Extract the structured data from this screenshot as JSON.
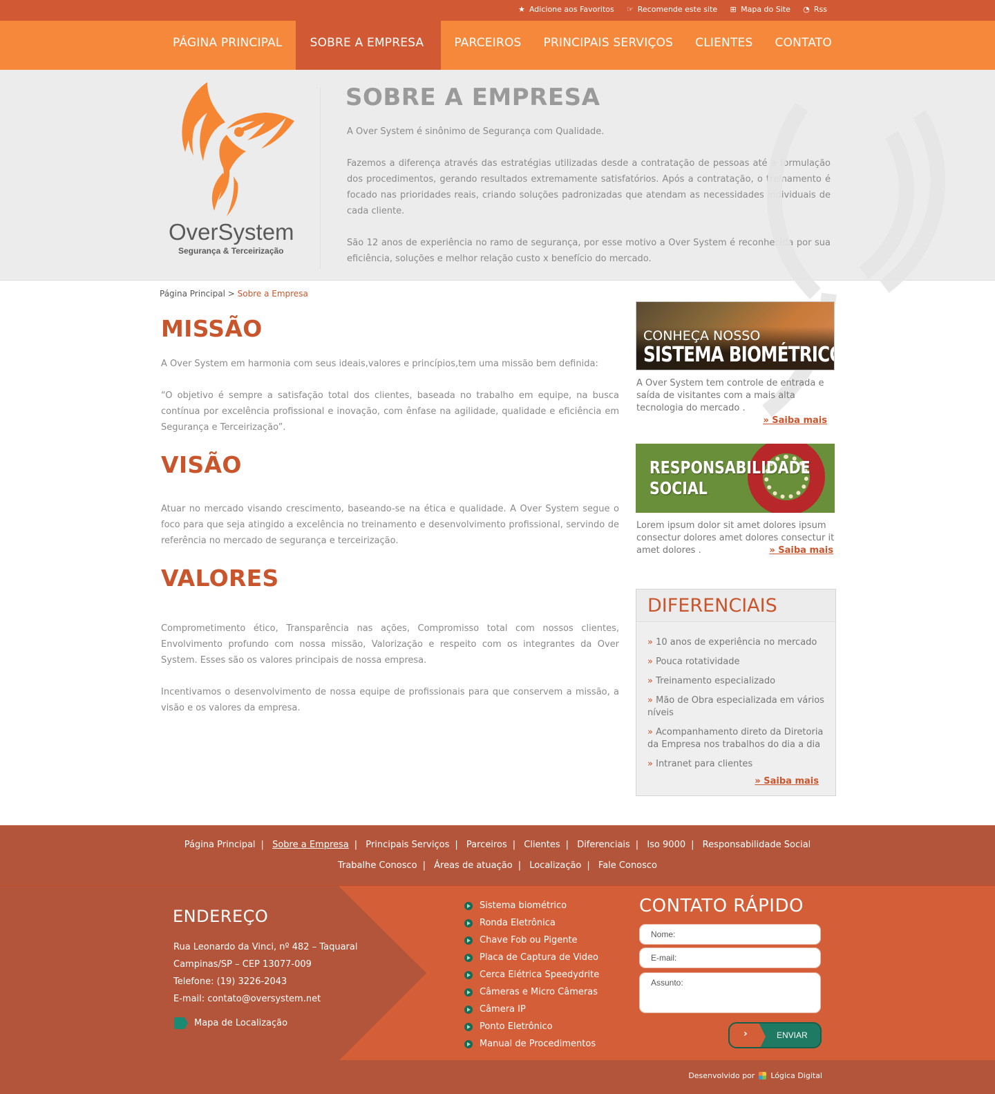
{
  "toplinks": [
    {
      "icon": "star-icon",
      "glyph": "★",
      "label": "Adicione aos Favoritos"
    },
    {
      "icon": "thumbs-up-icon",
      "glyph": "☞",
      "label": "Recomende este site"
    },
    {
      "icon": "sitemap-icon",
      "glyph": "⊞",
      "label": "Mapa do Site"
    },
    {
      "icon": "rss-icon",
      "glyph": "◔",
      "label": "Rss"
    }
  ],
  "nav": [
    {
      "label": "PÁGINA PRINCIPAL",
      "active": false
    },
    {
      "label": "SOBRE A EMPRESA",
      "active": true
    },
    {
      "label": "PARCEIROS",
      "active": false
    },
    {
      "label": "PRINCIPAIS SERVIÇOS",
      "active": false
    },
    {
      "label": "CLIENTES",
      "active": false
    },
    {
      "label": "CONTATO",
      "active": false
    }
  ],
  "logo": {
    "name": "OverSystem",
    "tagline": "Segurança & Terceirização"
  },
  "hero": {
    "title": "SOBRE A EMPRESA",
    "p1": "A Over System é sinônimo de Segurança com Qualidade.",
    "p2": "Fazemos a diferença através das estratégias utilizadas desde a contratação de pessoas até a formulação dos procedimentos, gerando resultados extremamente satisfatórios. Após a contratação, o treinamento é focado nas prioridades reais, criando soluções padronizadas que atendam as necessidades individuais de cada cliente.",
    "p3": "São 12 anos de experiência no ramo de segurança, por esse motivo a Over System é reconhecida por sua eficiência, soluções e melhor relação custo x benefício do mercado."
  },
  "breadcrumb": {
    "home": "Página Principal",
    "sep": ">",
    "current": "Sobre a Empresa"
  },
  "missao": {
    "title": "MISSÃO",
    "p1": "A Over System em harmonia com seus ideais,valores e princípios,tem uma missão bem definida:",
    "p2": "“O objetivo é sempre a satisfação total dos clientes, baseada no trabalho em equipe, na busca contínua por excelência profissional e inovação, com ênfase na agilidade, qualidade e eficiência em Segurança e Terceirização”."
  },
  "visao": {
    "title": "VISÃO",
    "p1": "Atuar no mercado visando crescimento, baseando-se na ética e qualidade. A Over System segue o foco para que seja atingido a excelência no treinamento e desenvolvimento profissional, servindo de referência no mercado de segurança e terceirização."
  },
  "valores": {
    "title": "VALORES",
    "p1": "Comprometimento ético, Transparência nas ações, Compromisso total com nossos clientes, Envolvimento profundo com nossa missão, Valorização e respeito com os integrantes da Over System. Esses são os valores principais de nossa empresa.",
    "p2": "Incentivamos o desenvolvimento de nossa equipe de profissionais para que conservem a missão, a visão e os valores da empresa."
  },
  "promo1": {
    "line1": "CONHEÇA NOSSO",
    "line2": "SISTEMA BIOMÉTRICO",
    "text": "A Over System tem controle de entrada e saída de visitantes com a mais alta tecnologia do mercado .",
    "more": "» Saiba mais"
  },
  "promo2": {
    "line1": "RESPONSABILIDADE",
    "line2": "SOCIAL",
    "text": "Lorem ipsum dolor sit amet dolores ipsum consectur dolores amet dolores consectur it amet dolores .",
    "more": "» Saiba mais"
  },
  "diferenciais": {
    "title": "DIFERENCIAIS",
    "items": [
      "10 anos de experiência no mercado",
      "Pouca rotatividade",
      "Treinamento especializado",
      "Mão de Obra especializada em vários níveis",
      "Acompanhamento direto da Diretoria da Empresa nos trabalhos do dia a dia",
      "Intranet para clientes"
    ],
    "more": "» Saiba mais"
  },
  "footer_nav": {
    "row1": [
      "Página Principal",
      "Sobre a Empresa",
      "Principais Serviços",
      "Parceiros",
      "Clientes",
      "Diferenciais",
      "Iso 9000",
      "Responsabilidade Social"
    ],
    "row2": [
      "Trabalhe Conosco",
      "Áreas de atuação",
      "Localização",
      "Fale Conosco"
    ],
    "separator": "|"
  },
  "endereco": {
    "title": "ENDEREÇO",
    "lines": [
      "Rua Leonardo da Vinci, nº 482 – Taquaral",
      "Campinas/SP – CEP 13077-009",
      "Telefone: (19) 3226-2043",
      "E-mail: contato@oversystem.net"
    ],
    "map": "Mapa de Localização"
  },
  "servicos": [
    "Sistema biométrico",
    "Ronda Eletrônica",
    "Chave Fob ou Pigente",
    "Placa de Captura de Video",
    "Cerca Elétrica Speedydrite",
    "Câmeras e Micro Câmeras",
    "Câmera IP",
    "Ponto Eletrônico",
    "Manual de Procedimentos"
  ],
  "contato": {
    "title": "CONTATO RÁPIDO",
    "nome": "Nome:",
    "email": "E-mail:",
    "assunto": "Assunto:",
    "send": "ENVIAR"
  },
  "credits": {
    "text": "Desenvolvido por",
    "brand": "Lógica Digital"
  },
  "colors": {
    "accent": "#d15a35",
    "nav": "#f5883b",
    "heading": "#c9552c",
    "footer": "#b3553a",
    "button": "#1e7a62"
  }
}
